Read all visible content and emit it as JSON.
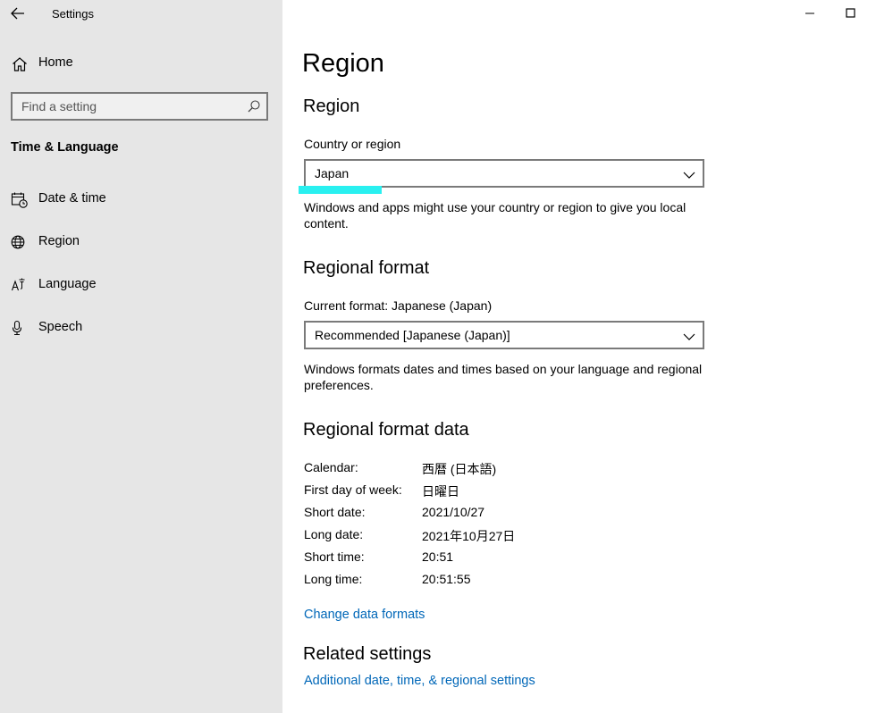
{
  "window": {
    "title": "Settings"
  },
  "sidebar": {
    "home_label": "Home",
    "search_placeholder": "Find a setting",
    "section_title": "Time & Language",
    "items": [
      {
        "label": "Date & time",
        "icon": "calendar-clock-icon"
      },
      {
        "label": "Region",
        "icon": "globe-icon"
      },
      {
        "label": "Language",
        "icon": "language-icon"
      },
      {
        "label": "Speech",
        "icon": "microphone-icon"
      }
    ]
  },
  "main": {
    "title": "Region",
    "region": {
      "heading": "Region",
      "country_label": "Country or region",
      "country_value": "Japan",
      "description": "Windows and apps might use your country or region to give you local content."
    },
    "format": {
      "heading": "Regional format",
      "current_label": "Current format: Japanese (Japan)",
      "dropdown_value": "Recommended [Japanese (Japan)]",
      "description": "Windows formats dates and times based on your language and regional preferences."
    },
    "format_data": {
      "heading": "Regional format data",
      "rows": [
        {
          "label": "Calendar:",
          "value": "西暦 (日本語)"
        },
        {
          "label": "First day of week:",
          "value": "日曜日"
        },
        {
          "label": "Short date:",
          "value": "2021/10/27"
        },
        {
          "label": "Long date:",
          "value": "2021年10月27日"
        },
        {
          "label": "Short time:",
          "value": "20:51"
        },
        {
          "label": "Long time:",
          "value": "20:51:55"
        }
      ],
      "change_link": "Change data formats"
    },
    "related": {
      "heading": "Related settings",
      "link": "Additional date, time, & regional settings"
    }
  },
  "colors": {
    "sidebar_bg": "#e6e6e6",
    "link": "#0067b8",
    "focus_highlight": "#29f0f0"
  }
}
